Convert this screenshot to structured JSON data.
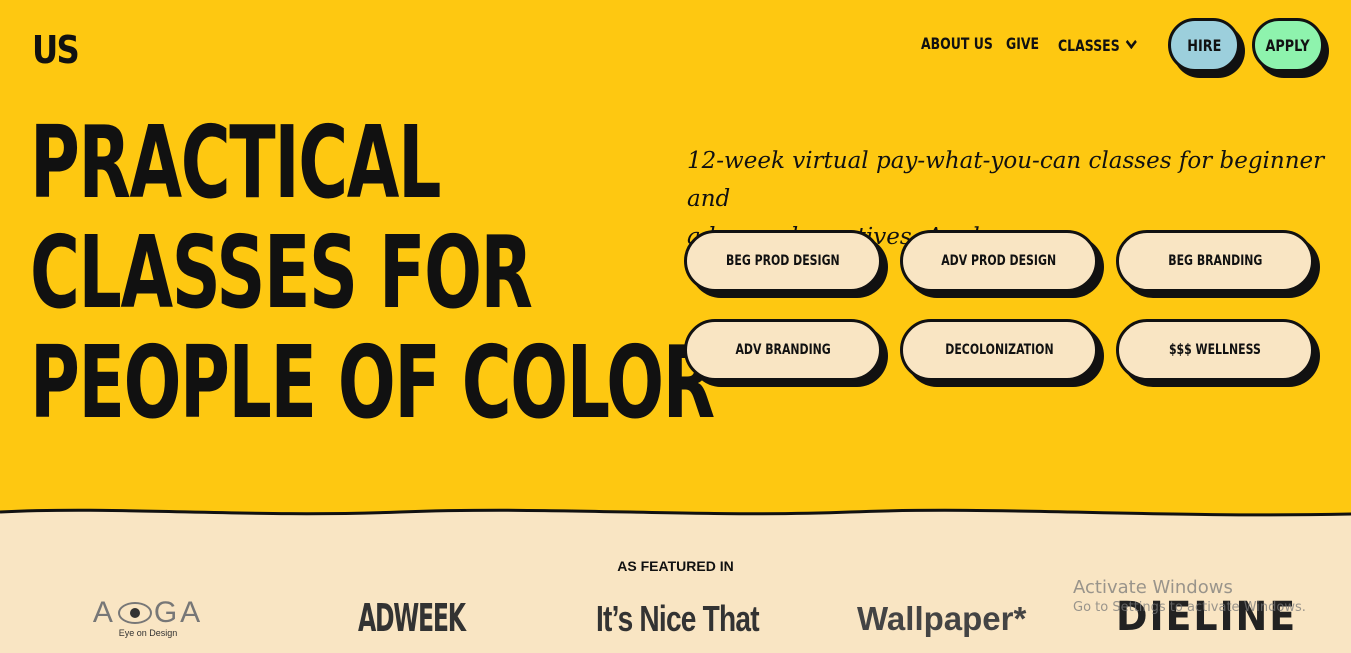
{
  "header": {
    "logo": "US",
    "nav": [
      "ABOUT US",
      "GIVE",
      "CLASSES"
    ],
    "hire_label": "HIRE",
    "apply_label": "APPLY"
  },
  "hero": {
    "headline": [
      "PRACTICAL",
      "CLASSES FOR",
      "PEOPLE OF COLOR"
    ],
    "subtitle_lines": [
      "12-week virtual pay-what-you-can classes for beginner and",
      "advanced creatives. Apply now."
    ],
    "classes": [
      "BEG PROD DESIGN",
      "ADV PROD DESIGN",
      "BEG BRANDING",
      "ADV BRANDING",
      "DECOLONIZATION",
      "$$$ WELLNESS"
    ]
  },
  "featured": {
    "title": "AS FEATURED IN",
    "logos": {
      "aoga_left": "A",
      "aoga_right": "GA",
      "aoga_sub": "Eye on Design",
      "adweek": "ADWEEK",
      "nicethat": "It’s Nice That",
      "wallpaper": "Wallpaper*",
      "dieline": "DIELINE"
    }
  },
  "overlay": {
    "activate_title": "Activate Windows",
    "activate_sub": "Go to Settings to activate Windows."
  },
  "colors": {
    "hero_bg": "#fec811",
    "cream": "#f9e5c3",
    "hire": "#9ccfdc",
    "apply": "#8ef3ad",
    "ink": "#111111"
  }
}
